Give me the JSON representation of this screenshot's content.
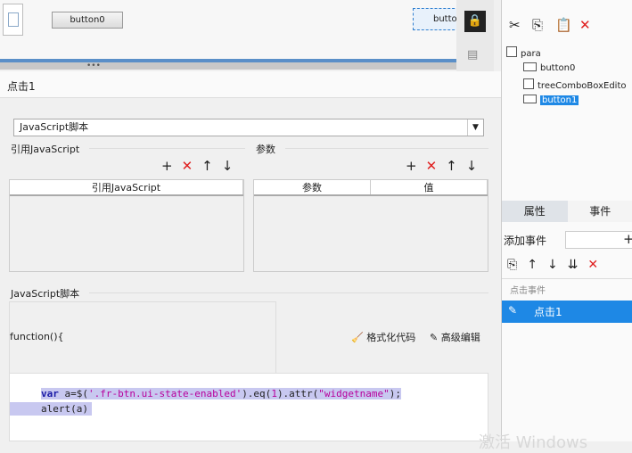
{
  "canvas": {
    "button0": "button0",
    "button1": "butto"
  },
  "tree": {
    "root": "para",
    "items": [
      "button0",
      "treeComboBoxEdito",
      "button1"
    ]
  },
  "rightpanel": {
    "tab_props": "属性",
    "tab_events": "事件",
    "add_event_label": "添加事件",
    "click_event_header": "点击事件",
    "event_item": "点击1"
  },
  "dialog": {
    "title": "点击1",
    "type_select": "JavaScript脚本",
    "ref_group": "引用JavaScript",
    "param_group": "参数",
    "ref_table_header": "引用JavaScript",
    "param_col": "参数",
    "value_col": "值",
    "script_group": "JavaScript脚本",
    "function_sig": "function(){",
    "format_code": "格式化代码",
    "advanced_edit": "高级编辑",
    "code": {
      "l1_kw": "var",
      "l1_a": " a=$(",
      "l1_s1": "'.fr-btn.ui-state-enabled'",
      "l1_b": ").eq(",
      "l1_n": "1",
      "l1_c": ").attr(",
      "l1_s2": "\"widgetname\"",
      "l1_d": ");",
      "l2": "alert(a)"
    }
  },
  "watermark": "激活 Windows",
  "colors": {
    "accent": "#1e88e5",
    "delete": "#e02020"
  }
}
